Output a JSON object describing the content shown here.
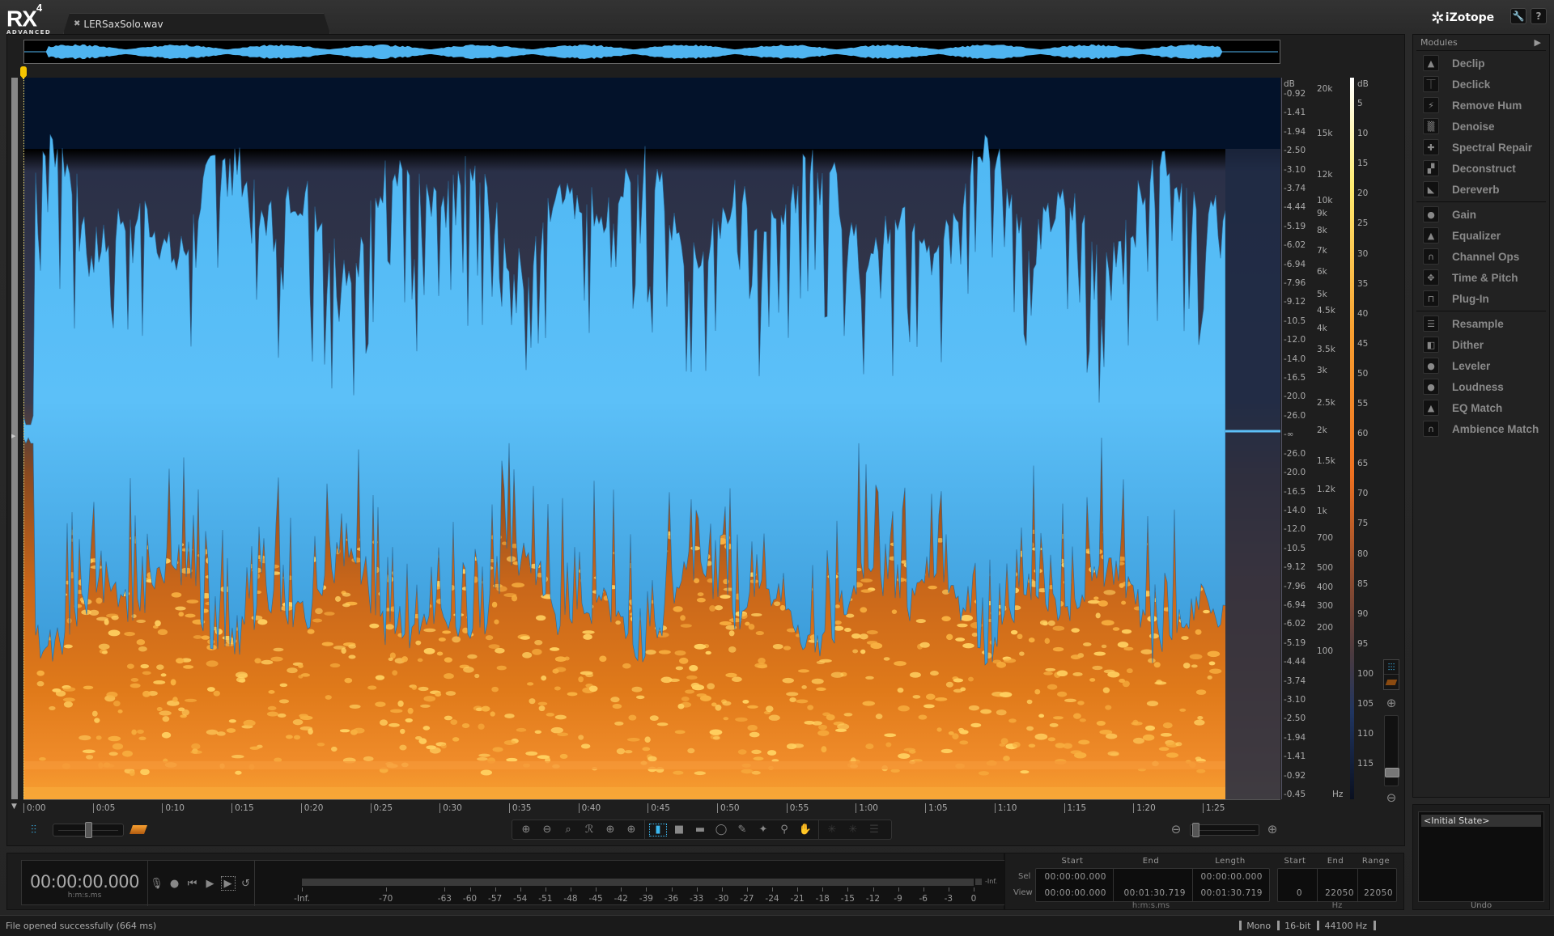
{
  "app": {
    "logo_text": "RX",
    "logo_version": "4",
    "logo_edition": "ADVANCED",
    "brand": "iZotope",
    "settings_icon": "wrench-icon",
    "help_label": "?"
  },
  "file_tab": {
    "close_label": "✖",
    "filename": "LERSaxSolo.wav"
  },
  "spectrogram": {
    "amplitude_axis": {
      "unit": "dB",
      "ticks": [
        "-0.92",
        "-1.41",
        "-1.94",
        "-2.50",
        "-3.10",
        "-3.74",
        "-4.44",
        "-5.19",
        "-6.02",
        "-6.94",
        "-7.96",
        "-9.12",
        "-10.5",
        "-12.0",
        "-14.0",
        "-16.5",
        "-20.0",
        "-26.0",
        "-∞",
        "-26.0",
        "-20.0",
        "-16.5",
        "-14.0",
        "-12.0",
        "-10.5",
        "-9.12",
        "-7.96",
        "-6.94",
        "-6.02",
        "-5.19",
        "-4.44",
        "-3.74",
        "-3.10",
        "-2.50",
        "-1.94",
        "-1.41",
        "-0.92",
        "-0.45"
      ]
    },
    "frequency_axis": {
      "unit": "Hz",
      "ticks": [
        "20k",
        "15k",
        "12k",
        "10k",
        "9k",
        "8k",
        "7k",
        "6k",
        "5k",
        "4.5k",
        "4k",
        "3.5k",
        "3k",
        "2.5k",
        "2k",
        "1.5k",
        "1.2k",
        "1k",
        "700",
        "500",
        "400",
        "300",
        "200",
        "100"
      ]
    },
    "color_scale": {
      "unit": "dB",
      "ticks": [
        "5",
        "10",
        "15",
        "20",
        "25",
        "30",
        "35",
        "40",
        "45",
        "50",
        "55",
        "60",
        "65",
        "70",
        "75",
        "80",
        "85",
        "90",
        "95",
        "100",
        "105",
        "110",
        "115"
      ]
    },
    "time_axis": {
      "ticks": [
        "0:00",
        "0:05",
        "0:10",
        "0:15",
        "0:20",
        "0:25",
        "0:30",
        "0:35",
        "0:40",
        "0:45",
        "0:50",
        "0:55",
        "1:00",
        "1:05",
        "1:10",
        "1:15",
        "1:20",
        "1:25"
      ]
    },
    "colors": {
      "waveform": "#4fb4f0",
      "spectrum_hot": "#f6a02e",
      "background": "#03122a"
    }
  },
  "view_controls": {
    "waveform_view_icon": "waveform-icon",
    "spectrogram_view_icon": "spectrogram-icon",
    "zoom_in_icon": "zoom-in-icon",
    "zoom_out_icon": "zoom-out-icon"
  },
  "toolbar": {
    "tools": [
      {
        "name": "zoom-in-tool",
        "glyph": "⊕"
      },
      {
        "name": "zoom-out-tool",
        "glyph": "⊖"
      },
      {
        "name": "zoom-to-selection-tool",
        "glyph": "⌕"
      },
      {
        "name": "zoom-reset-tool",
        "glyph": "ℛ"
      },
      {
        "name": "zoom-time-tool",
        "glyph": "⊕"
      },
      {
        "name": "zoom-freq-tool",
        "glyph": "⊕"
      },
      {
        "name": "time-selection-tool",
        "glyph": "▮",
        "active": true
      },
      {
        "name": "time-freq-selection-tool",
        "glyph": "■"
      },
      {
        "name": "freq-selection-tool",
        "glyph": "▬"
      },
      {
        "name": "lasso-tool",
        "glyph": "◯"
      },
      {
        "name": "brush-tool",
        "glyph": "✎"
      },
      {
        "name": "magic-wand-tool",
        "glyph": "✦"
      },
      {
        "name": "find-similar-tool",
        "glyph": "⚲"
      },
      {
        "name": "hand-tool",
        "glyph": "✋"
      },
      {
        "name": "harmonic-tool-1",
        "glyph": "✳",
        "disabled": true
      },
      {
        "name": "harmonic-tool-2",
        "glyph": "✳",
        "disabled": true
      },
      {
        "name": "harmonic-tool-3",
        "glyph": "☰",
        "disabled": true
      }
    ]
  },
  "modules": {
    "header": "Modules",
    "groups": [
      [
        {
          "label": "Declip",
          "icon": "declip-icon",
          "glyph": "▲"
        },
        {
          "label": "Declick",
          "icon": "declick-icon",
          "glyph": "⏉"
        },
        {
          "label": "Remove Hum",
          "icon": "remove-hum-icon",
          "glyph": "⚡"
        },
        {
          "label": "Denoise",
          "icon": "denoise-icon",
          "glyph": "▒"
        },
        {
          "label": "Spectral Repair",
          "icon": "spectral-repair-icon",
          "glyph": "✚"
        },
        {
          "label": "Deconstruct",
          "icon": "deconstruct-icon",
          "glyph": "▞"
        },
        {
          "label": "Dereverb",
          "icon": "dereverb-icon",
          "glyph": "◣"
        }
      ],
      [
        {
          "label": "Gain",
          "icon": "gain-icon",
          "glyph": "●"
        },
        {
          "label": "Equalizer",
          "icon": "equalizer-icon",
          "glyph": "▲"
        },
        {
          "label": "Channel Ops",
          "icon": "channel-ops-icon",
          "glyph": "∩"
        },
        {
          "label": "Time & Pitch",
          "icon": "time-pitch-icon",
          "glyph": "✥"
        },
        {
          "label": "Plug-In",
          "icon": "plug-in-icon",
          "glyph": "⊓"
        }
      ],
      [
        {
          "label": "Resample",
          "icon": "resample-icon",
          "glyph": "☰"
        },
        {
          "label": "Dither",
          "icon": "dither-icon",
          "glyph": "◧"
        },
        {
          "label": "Leveler",
          "icon": "leveler-icon",
          "glyph": "●"
        },
        {
          "label": "Loudness",
          "icon": "loudness-icon",
          "glyph": "●"
        },
        {
          "label": "EQ Match",
          "icon": "eq-match-icon",
          "glyph": "▲"
        },
        {
          "label": "Ambience Match",
          "icon": "ambience-match-icon",
          "glyph": "∩"
        }
      ]
    ]
  },
  "transport": {
    "time": "00:00:00.000",
    "time_unit": "h:m:s.ms",
    "buttons": [
      {
        "name": "record-arm-button",
        "glyph": "🎙"
      },
      {
        "name": "record-button",
        "glyph": "●"
      },
      {
        "name": "go-to-start-button",
        "glyph": "⏮"
      },
      {
        "name": "play-button",
        "glyph": "▶"
      },
      {
        "name": "loop-play-button",
        "glyph": "▶"
      },
      {
        "name": "return-button",
        "glyph": "↺"
      }
    ],
    "meter": {
      "ticks": [
        "-Inf.",
        "-70",
        "-63",
        "-60",
        "-57",
        "-54",
        "-51",
        "-48",
        "-45",
        "-42",
        "-39",
        "-36",
        "-33",
        "-30",
        "-27",
        "-24",
        "-21",
        "-18",
        "-15",
        "-12",
        "-9",
        "-6",
        "-3",
        "0"
      ],
      "peak_label": "-Inf."
    }
  },
  "selection_view": {
    "time_headers": [
      "Start",
      "End",
      "Length"
    ],
    "freq_headers": [
      "Start",
      "End",
      "Range"
    ],
    "rows": [
      {
        "label": "Sel",
        "start": "00:00:00.000",
        "end": "",
        "length": "00:00:00.000",
        "f_start": "",
        "f_end": "",
        "f_range": ""
      },
      {
        "label": "View",
        "start": "00:00:00.000",
        "end": "00:01:30.719",
        "length": "00:01:30.719",
        "f_start": "0",
        "f_end": "22050",
        "f_range": "22050"
      }
    ],
    "time_unit": "h:m:s.ms",
    "freq_unit": "Hz"
  },
  "undo": {
    "items": [
      "<Initial State>"
    ],
    "label": "Undo"
  },
  "status": {
    "message": "File opened successfully (664 ms)",
    "channels": "Mono",
    "bit_depth": "16-bit",
    "sample_rate": "44100 Hz"
  }
}
